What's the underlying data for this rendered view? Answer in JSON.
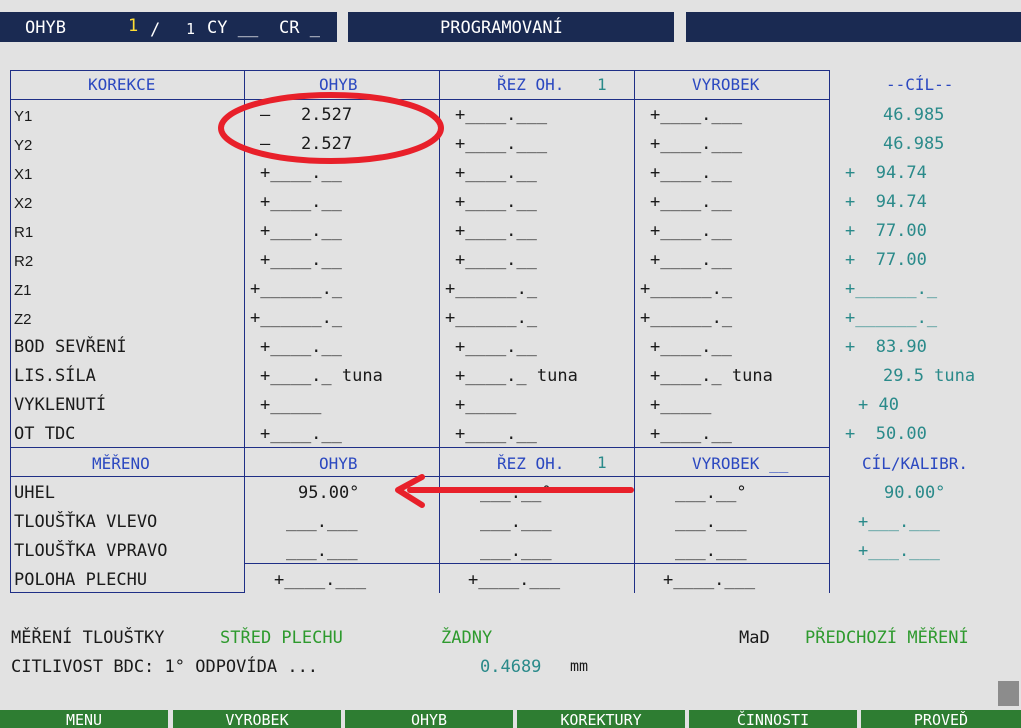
{
  "header": {
    "ohyb_label": "OHYB",
    "ohyb_num": "1",
    "slash": "/",
    "total": "1",
    "cy": "CY __",
    "cr": "CR _",
    "mode": "PROGRAMOVANÍ"
  },
  "table": {
    "headers": [
      "KOREKCE",
      "OHYB",
      "ŘEZ OH.",
      "VYROBEK",
      "--CÍL--"
    ],
    "rez_num": "1",
    "rows": [
      {
        "label": "Y1",
        "ohyb": "–   2.527",
        "rez": "+____.___",
        "vyr": "+____.___",
        "cil": "46.985"
      },
      {
        "label": "Y2",
        "ohyb": "–   2.527",
        "rez": "+____.___",
        "vyr": "+____.___",
        "cil": "46.985"
      },
      {
        "label": "X1",
        "ohyb": "+____.__",
        "rez": "+____.__",
        "vyr": "+____.__",
        "cil": "+  94.74"
      },
      {
        "label": "X2",
        "ohyb": "+____.__",
        "rez": "+____.__",
        "vyr": "+____.__",
        "cil": "+  94.74"
      },
      {
        "label": "R1",
        "ohyb": "+____.__",
        "rez": "+____.__",
        "vyr": "+____.__",
        "cil": "+  77.00"
      },
      {
        "label": "R2",
        "ohyb": "+____.__",
        "rez": "+____.__",
        "vyr": "+____.__",
        "cil": "+  77.00"
      },
      {
        "label": "Z1",
        "ohyb": "+______._",
        "rez": "+______._",
        "vyr": "+______._",
        "cil": "+______._"
      },
      {
        "label": "Z2",
        "ohyb": "+______._",
        "rez": "+______._",
        "vyr": "+______._",
        "cil": "+______._"
      },
      {
        "label": "BOD SEVŘENÍ",
        "ohyb": "+____.__",
        "rez": "+____.__",
        "vyr": "+____.__",
        "cil": "+  83.90"
      },
      {
        "label": "LIS.SÍLA",
        "ohyb": "+____._ tuna",
        "rez": "+____._ tuna",
        "vyr": "+____._ tuna",
        "cil": "29.5 tuna"
      },
      {
        "label": "VYKLENUTÍ",
        "ohyb": "+_____",
        "rez": "+_____",
        "vyr": "+_____",
        "cil": "+ 40"
      },
      {
        "label": "OT TDC",
        "ohyb": "+____.__",
        "rez": "+____.__",
        "vyr": "+____.__",
        "cil": "+  50.00"
      }
    ]
  },
  "measure": {
    "headers": [
      "MĚŘENO",
      "OHYB",
      "ŘEZ OH.",
      "VYROBEK __",
      "CÍL/KALIBR."
    ],
    "rez_num": "1",
    "rows": [
      {
        "label": "UHEL",
        "ohyb": "95.00°",
        "rez": "___.__°",
        "vyr": "___.__°",
        "cil": "90.00°"
      },
      {
        "label": "TLOUŠŤKA VLEVO",
        "ohyb": "___.___",
        "rez": "___.___",
        "vyr": "___.___",
        "cil": "+___.___"
      },
      {
        "label": "TLOUŠŤKA VPRAVO",
        "ohyb": "___.___",
        "rez": "___.___",
        "vyr": "___.___",
        "cil": "+___.___"
      },
      {
        "label": "POLOHA PLECHU",
        "ohyb": "+____.___",
        "rez": "+____.___",
        "vyr": "+____.___",
        "cil": ""
      }
    ]
  },
  "bottom": {
    "mereni_label": "MĚŘENÍ TLOUŠTKY",
    "stred": "STŘED PLECHU",
    "zadny": "ŽADNY",
    "mad": "MaD",
    "predchozi": "PŘEDCHOZÍ MĚŘENÍ",
    "citlivost": "CITLIVOST BDC: 1° ODPOVÍDA ...",
    "value": "0.4689",
    "unit": "mm"
  },
  "fkeys": [
    "MENU",
    "VYROBEK",
    "OHYB",
    "KOREKTURY",
    "ČINNOSTI",
    "PROVEĎ"
  ],
  "colors": {
    "accent": "#2b48c0",
    "header_bg": "#1a2a52",
    "annotation": "#e8202a",
    "fkey_bg": "#2e7d32"
  }
}
